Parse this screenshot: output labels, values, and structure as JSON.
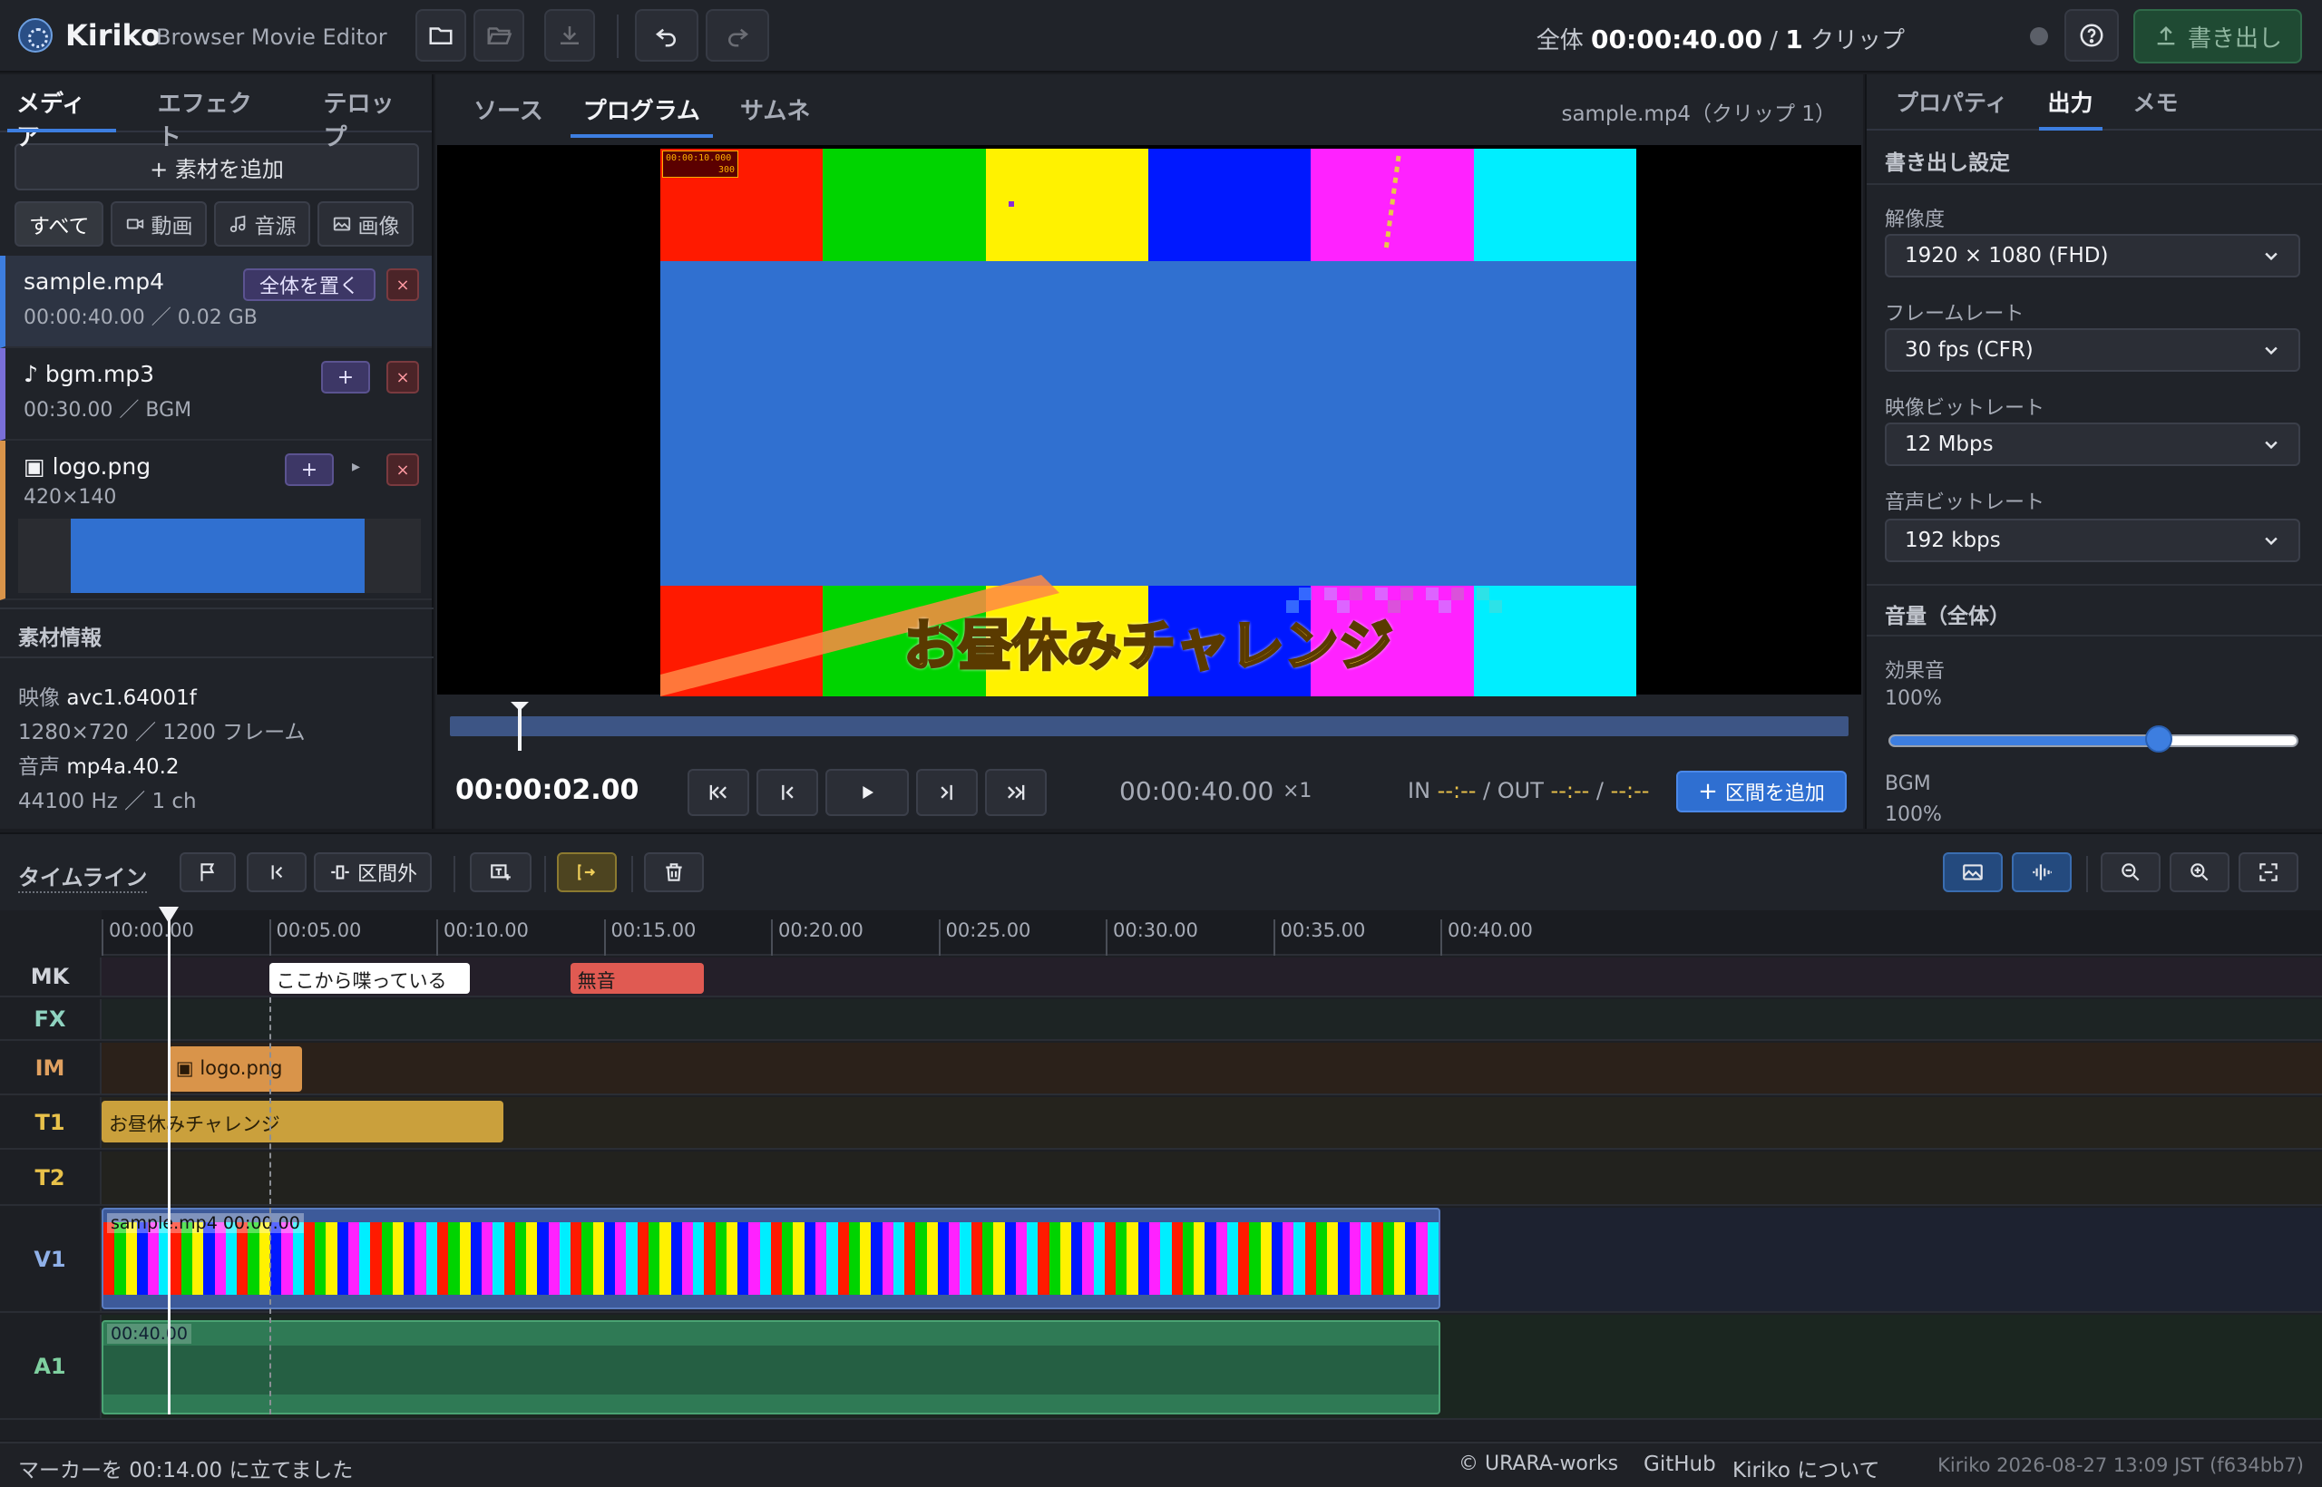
{
  "app": {
    "name": "Kiriko",
    "subtitle": "Browser Movie Editor"
  },
  "header": {
    "total_label": "全体",
    "total_time": "00:00:40.00",
    "clips_separator": "/",
    "clip_count": "1",
    "clip_unit": "クリップ",
    "export_label": "書き出し"
  },
  "left": {
    "tabs": [
      "メディア",
      "エフェクト",
      "テロップ"
    ],
    "add_material": "+ 素材を追加",
    "filters": [
      "すべて",
      "動画",
      "音源",
      "画像"
    ],
    "items": [
      {
        "name": "sample.mp4",
        "meta": "00:00:40.00 ／ 0.02 GB",
        "action": "全体を置く",
        "accent": "#3d7ee0"
      },
      {
        "name": "♪ bgm.mp3",
        "meta": "00:30.00 ／ BGM",
        "action": "+",
        "accent": "#7a6fd8"
      },
      {
        "name": "▣ logo.png",
        "meta": "420×140",
        "action": "+",
        "accent": "#d9944a"
      }
    ],
    "delete_symbol": "×",
    "expand_symbol": "▸",
    "info_title": "素材情報",
    "info": {
      "video_label": "映像",
      "video_codec": "avc1.64001f",
      "video_detail": "1280×720 ／ 1200 フレーム",
      "audio_label": "音声",
      "audio_codec": "mp4a.40.2",
      "audio_detail": "44100 Hz ／ 1 ch"
    }
  },
  "preview": {
    "tabs": [
      "ソース",
      "プログラム",
      "サムネ"
    ],
    "active_tab": 1,
    "clip_name": "sample.mp4（クリップ 1）",
    "frame_counter_time": "00:00:10.000",
    "frame_counter_num": "300",
    "caption": "お昼休みチャレンジ",
    "current_time": "00:00:02.00",
    "duration": "00:00:40.00",
    "speed": "×1",
    "in_label": "IN",
    "in_value": "--:--",
    "out_label": "OUT",
    "out_value": "--:--",
    "range_value": "--:--",
    "add_range": "区間を追加",
    "progress": 0.05,
    "bar_colors": [
      "#ff1a00",
      "#00d400",
      "#fff200",
      "#0018ff",
      "#ff22ff",
      "#00eeff"
    ],
    "center_color": "#3070d0"
  },
  "right": {
    "tabs": [
      "プロパティ",
      "出力",
      "メモ"
    ],
    "active_tab": 1,
    "section_export": "書き出し設定",
    "resolution_label": "解像度",
    "resolution_value": "1920 × 1080 (FHD)",
    "framerate_label": "フレームレート",
    "framerate_value": "30 fps (CFR)",
    "vbitrate_label": "映像ビットレート",
    "vbitrate_value": "12 Mbps",
    "abitrate_label": "音声ビットレート",
    "abitrate_value": "192 kbps",
    "section_volume": "音量（全体）",
    "sfx_label": "効果音",
    "sfx_value": "100%",
    "sfx_level": 0.66,
    "bgm_label": "BGM",
    "bgm_value": "100%"
  },
  "timeline": {
    "title": "タイムライン",
    "outside_range": "区間外",
    "ruler": [
      "00:00.00",
      "00:05.00",
      "00:10.00",
      "00:15.00",
      "00:20.00",
      "00:25.00",
      "00:30.00",
      "00:35.00",
      "00:40.00"
    ],
    "lanes": {
      "mk": "MK",
      "fx": "FX",
      "im": "IM",
      "t1": "T1",
      "t2": "T2",
      "v1": "V1",
      "a1": "A1"
    },
    "markers": [
      {
        "label": "ここから喋っている",
        "start": 5.0,
        "end": 11.0,
        "color": "#ffffff"
      },
      {
        "label": "無音",
        "start": 14.0,
        "end": 18.0,
        "color": "#e05a52"
      }
    ],
    "image_clip": {
      "label": "▣ logo.png",
      "start": 2.0,
      "end": 6.0
    },
    "text_clip": {
      "label": "お昼休みチャレンジ",
      "start": 0.0,
      "end": 12.0
    },
    "video_clip": {
      "label": "sample.mp4  00:00.00",
      "start": 0.0,
      "end": 40.0
    },
    "audio_clip": {
      "label": "00:40.00",
      "start": 0.0,
      "end": 40.0
    },
    "playhead": 2.0,
    "marker_line": 5.0
  },
  "status": {
    "message": "マーカーを 00:14.00 に立てました",
    "copyright": "© URARA-works",
    "github": "GitHub",
    "about": "Kiriko について",
    "version": "Kiriko 2026-08-27 13:09 JST (f634bb7)"
  }
}
